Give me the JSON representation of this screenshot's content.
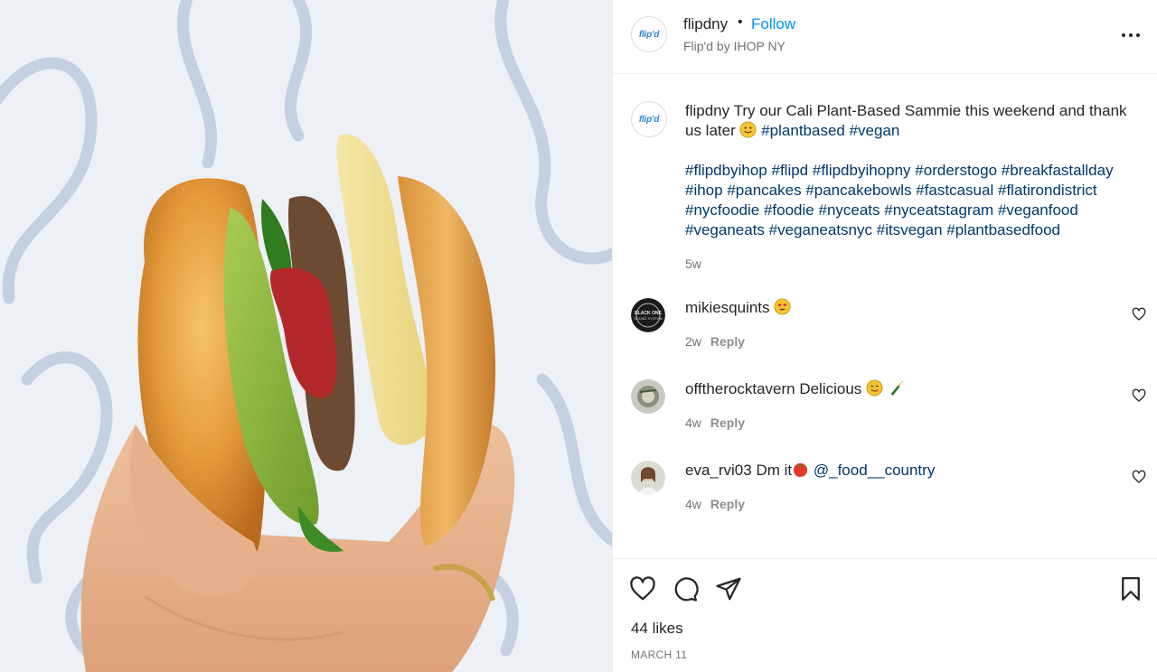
{
  "post": {
    "author": {
      "username": "flipdny",
      "separator": "•",
      "follow_label": "Follow",
      "location": "Flip'd by IHOP NY",
      "avatar_text": "flip'd"
    },
    "caption": {
      "username": "flipdny",
      "text": "Try our Cali Plant-Based Sammie this weekend and thank us later",
      "emoji": "smiling-face-emoji",
      "tags_inline": [
        "#plantbased",
        "#vegan"
      ],
      "hashtags": [
        "#flipdbyihop",
        "#flipd",
        "#flipdbyihopny",
        "#orderstogo",
        "#breakfastallday",
        "#ihop",
        "#pancakes",
        "#pancakebowls",
        "#fastcasual",
        "#flatirondistrict",
        "#nycfoodie",
        "#foodie",
        "#nyceats",
        "#nyceatstagram",
        "#veganfood",
        "#veganeats",
        "#veganeatsnyc",
        "#itsvegan",
        "#plantbasedfood"
      ],
      "age": "5w"
    },
    "comments": [
      {
        "username": "mikiesquints",
        "text": "",
        "emoji": "heart-eyes-emoji",
        "age": "2w",
        "reply_label": "Reply"
      },
      {
        "username": "offtherocktavern",
        "text": "Delicious",
        "emoji": "yum-face-emoji, champagne-bottle-emoji",
        "age": "4w",
        "reply_label": "Reply"
      },
      {
        "username": "eva_rvi03",
        "text": "Dm it",
        "emoji": "tomato-emoji",
        "mention": "@_food__country",
        "age": "4w",
        "reply_label": "Reply"
      }
    ],
    "likes": "44 likes",
    "date": "MARCH 11",
    "colors": {
      "link_blue": "#0095f6",
      "hashtag": "#00376b",
      "muted": "#737373",
      "text": "#262626",
      "divider": "#efefef"
    },
    "icons": [
      "more-options-icon",
      "like-heart-icon",
      "comment-icon",
      "share-icon",
      "save-bookmark-icon",
      "comment-like-icon"
    ]
  }
}
